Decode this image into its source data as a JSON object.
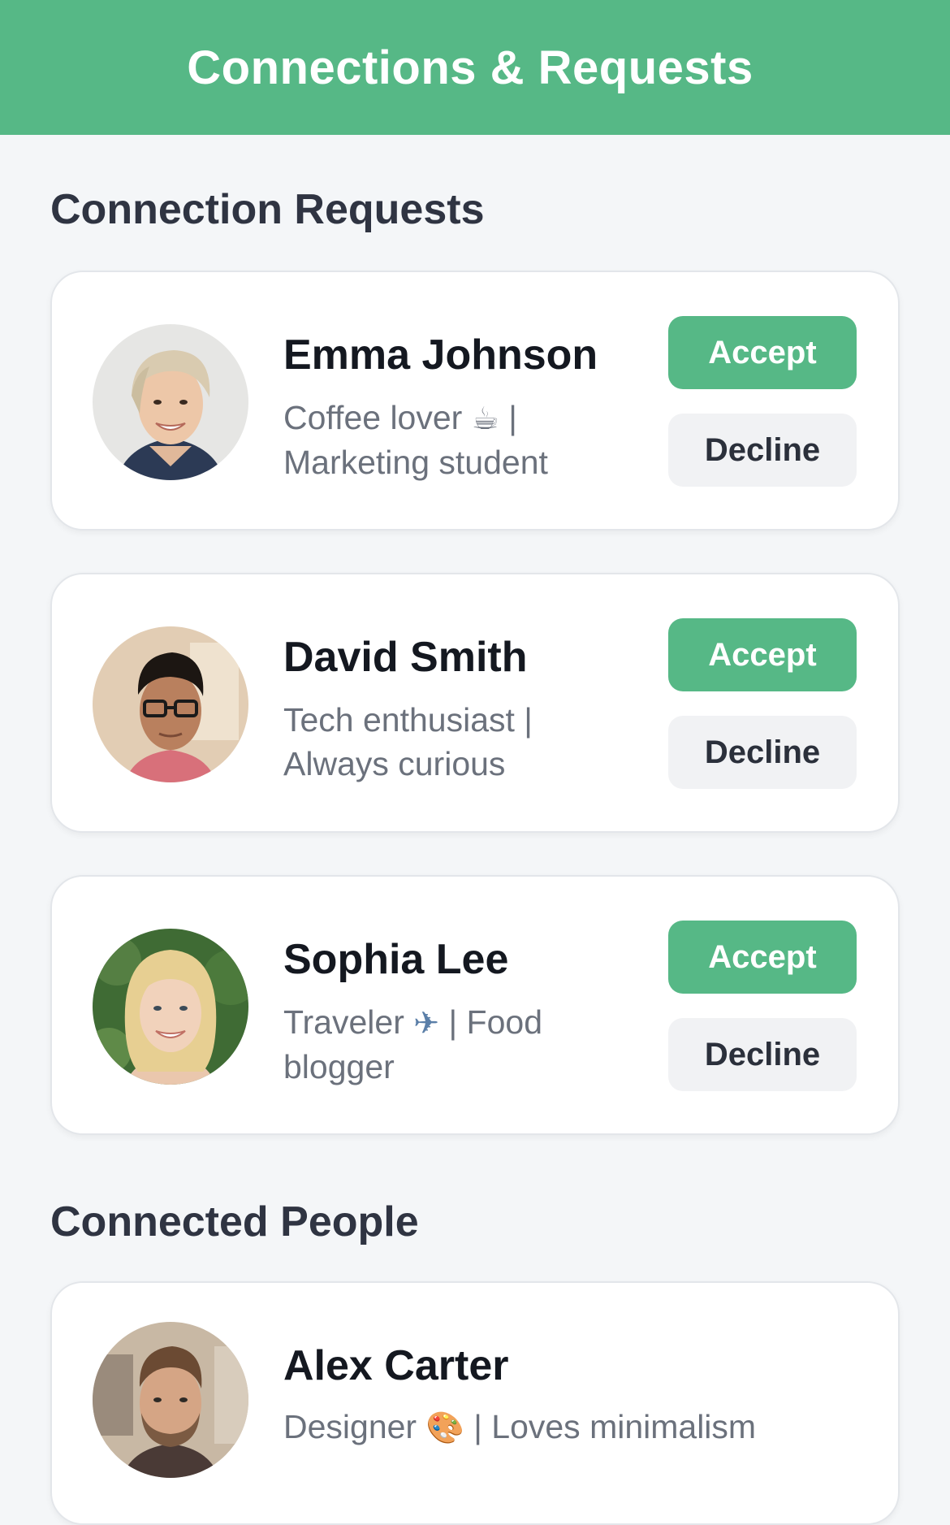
{
  "header": {
    "title": "Connections & Requests"
  },
  "sections": {
    "requests_title": "Connection Requests",
    "connected_title": "Connected People"
  },
  "requests": [
    {
      "name": "Emma Johnson",
      "bio_line1": "Coffee lover",
      "bio_emoji": "☕",
      "bio_line1_tail": "|",
      "bio_line2": "Marketing student",
      "accept_label": "Accept",
      "decline_label": "Decline",
      "avatar_icon": "avatar-photo"
    },
    {
      "name": "David Smith",
      "bio_line1": "Tech enthusiast |",
      "bio_line2": "Always curious",
      "accept_label": "Accept",
      "decline_label": "Decline",
      "avatar_icon": "avatar-photo"
    },
    {
      "name": "Sophia Lee",
      "bio_line1": "Traveler",
      "bio_emoji": "✈",
      "bio_line1_tail": "| Food",
      "bio_line2": "blogger",
      "accept_label": "Accept",
      "decline_label": "Decline",
      "avatar_icon": "avatar-photo"
    }
  ],
  "connected": [
    {
      "name": "Alex Carter",
      "bio_line1": "Designer",
      "bio_emoji": "🎨",
      "bio_line1_tail": "| Loves minimalism",
      "avatar_icon": "avatar-photo"
    }
  ],
  "colors": {
    "accent": "#56b886",
    "background": "#f4f6f8",
    "card": "#ffffff",
    "decline_bg": "#f1f2f4",
    "title_text": "#2f3442",
    "name_text": "#141820",
    "bio_text": "#6b717c"
  }
}
